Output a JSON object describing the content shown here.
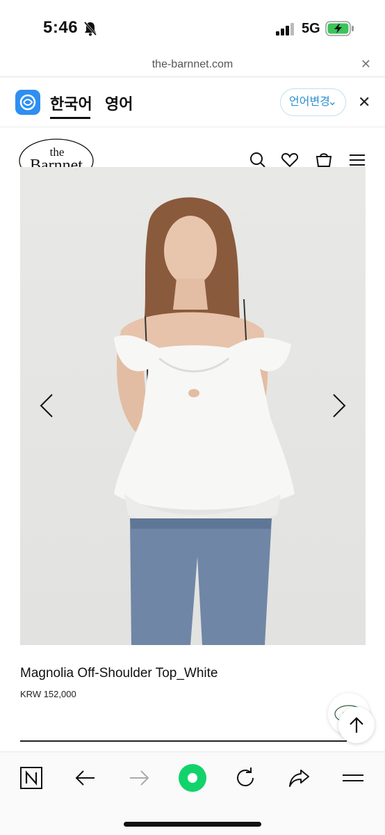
{
  "status_bar": {
    "time": "5:46",
    "network": "5G",
    "icons": [
      "bell-off-icon",
      "signal-icon",
      "battery-charging-icon"
    ]
  },
  "browser": {
    "url": "the-barnnet.com"
  },
  "translate_bar": {
    "source_lang": "한국어",
    "target_lang": "영어",
    "change_label": "언어변경",
    "accent_color": "#2e8ff0"
  },
  "site": {
    "logo_top": "the",
    "logo_bottom": "Barnnet",
    "header_icons": [
      "search-icon",
      "heart-icon",
      "shopping-bag-icon",
      "menu-icon"
    ]
  },
  "product": {
    "name": "Magnolia Off-Shoulder Top_White",
    "price": "KRW 152,000"
  },
  "toolbar": {
    "icons": [
      "naver-icon",
      "back-icon",
      "forward-icon",
      "green-dot-icon",
      "refresh-icon",
      "share-icon",
      "menu-icon"
    ]
  }
}
